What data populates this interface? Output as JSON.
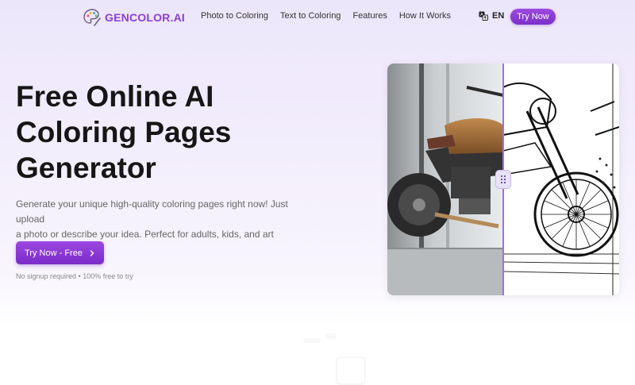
{
  "header": {
    "brand": "GENCOLOR.AI",
    "nav": [
      "Photo to Coloring",
      "Text to Coloring",
      "Features",
      "How It Works"
    ],
    "language": "EN",
    "try_now": "Try Now"
  },
  "hero": {
    "title_lines": [
      "Free Online AI",
      "Coloring Pages",
      "Generator"
    ],
    "description_lines": [
      "Generate your unique high-quality coloring pages right now! Just upload",
      "a photo or describe your idea. Perfect for adults, kids, and art therapy."
    ],
    "cta": "Try Now - Free",
    "note": "No signup required • 100% free to try"
  },
  "icons": {
    "logo": "palette-icon",
    "language": "translate-icon",
    "cta": "chevron-right-icon",
    "handle": "drag-handle-icon"
  },
  "colors": {
    "brand": "#8b3fd6",
    "button_gradient_top": "#9d48e2",
    "button_gradient_bottom": "#7a2bc8"
  }
}
